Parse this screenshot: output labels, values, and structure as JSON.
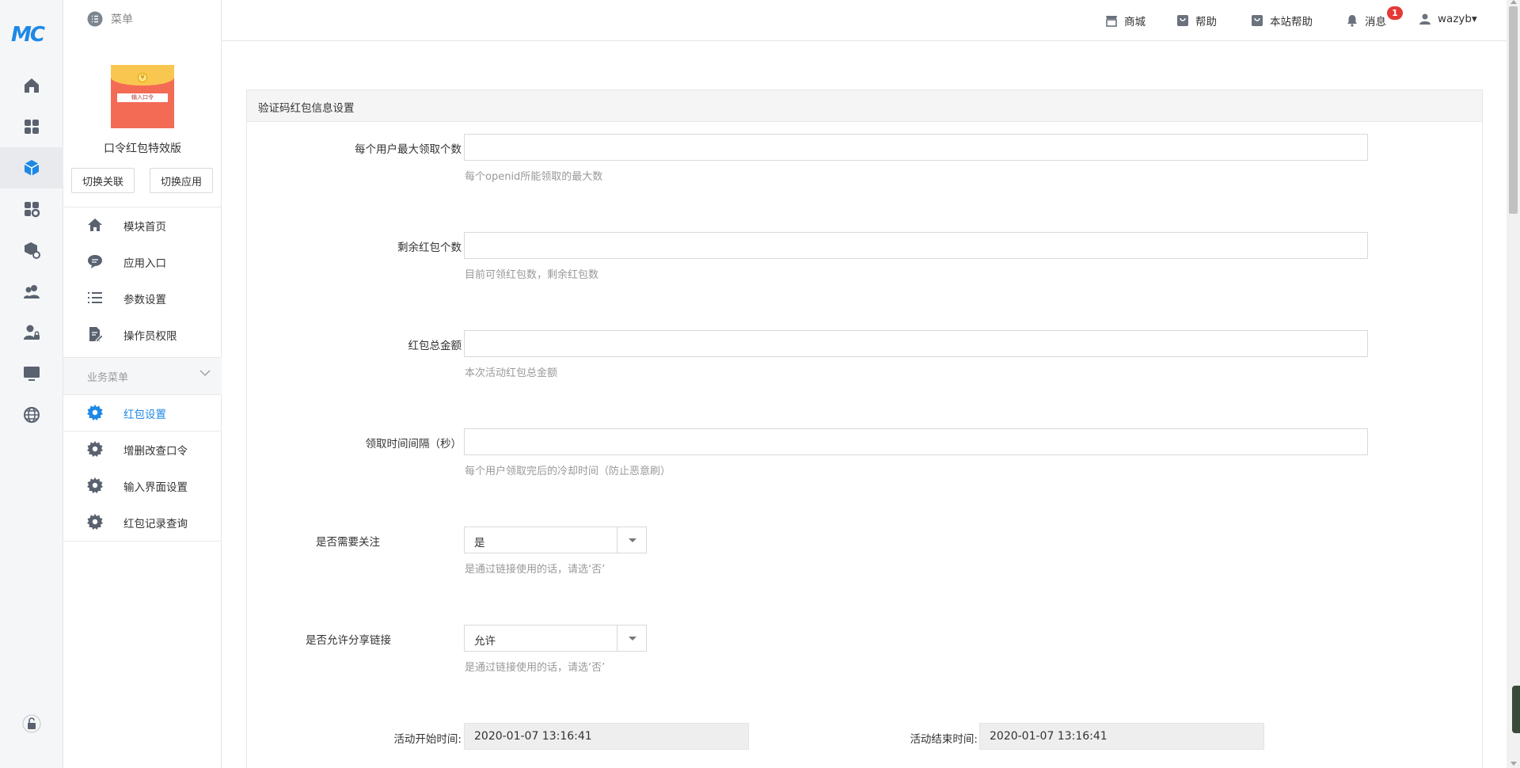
{
  "app": {
    "logo_text": "MC"
  },
  "topbar": {
    "menu_label": "菜单",
    "links": [
      {
        "icon": "store-icon",
        "label": "商城"
      },
      {
        "icon": "help-bag-icon",
        "label": "帮助"
      },
      {
        "icon": "help-bag-icon",
        "label": "本站帮助"
      },
      {
        "icon": "bell-icon",
        "label": "消息",
        "badge": "1"
      }
    ],
    "user": {
      "name": "wazyb▾"
    }
  },
  "rail": {
    "items": [
      "home-icon",
      "apps-grid-icon",
      "cube-icon",
      "apps-settings-icon",
      "package-settings-icon",
      "users-icon",
      "user-lock-icon",
      "monitor-icon",
      "globe-icon"
    ],
    "active_index": 2,
    "bottom": "unlock-icon"
  },
  "module": {
    "thumb_slip_text": "输入口令",
    "thumb_coin": "¥",
    "title": "口令红包特效版",
    "switch_link": "切换关联",
    "switch_app": "切换应用",
    "nav": [
      {
        "icon": "home-icon",
        "label": "模块首页"
      },
      {
        "icon": "chat-icon",
        "label": "应用入口"
      },
      {
        "icon": "list-icon",
        "label": "参数设置"
      },
      {
        "icon": "document-edit-icon",
        "label": "操作员权限"
      }
    ],
    "section_label": "业务菜单",
    "business": [
      {
        "icon": "gear-icon",
        "label": "红包设置",
        "active": true
      },
      {
        "icon": "gear-icon",
        "label": "增删改查口令"
      },
      {
        "icon": "gear-icon",
        "label": "输入界面设置"
      },
      {
        "icon": "gear-icon",
        "label": "红包记录查询"
      }
    ]
  },
  "panel": {
    "title": "验证码红包信息设置",
    "fields": [
      {
        "label": "每个用户最大领取个数",
        "value": "",
        "help": "每个openid所能领取的最大数"
      },
      {
        "label": "剩余红包个数",
        "value": "",
        "help": "目前可领红包数，剩余红包数"
      },
      {
        "label": "红包总金额",
        "value": "",
        "help": "本次活动红包总金额"
      },
      {
        "label": "领取时间间隔（秒）",
        "value": "",
        "help": "每个用户领取完后的冷却时间（防止恶意刷）"
      }
    ],
    "selects": [
      {
        "label": "是否需要关注",
        "value": "是",
        "help": "是通过链接使用的话，请选‘否’"
      },
      {
        "label": "是否允许分享链接",
        "value": "允许",
        "help": "是通过链接使用的话，请选‘否’"
      }
    ],
    "start_label": "活动开始时间:",
    "start_value": "2020-01-07 13:16:41",
    "end_label": "活动结束时间:",
    "end_value": "2020-01-07 13:16:41"
  },
  "colors": {
    "accent": "#1e88e5",
    "badge": "#e53935",
    "rail_bg": "#f5f6f8"
  }
}
